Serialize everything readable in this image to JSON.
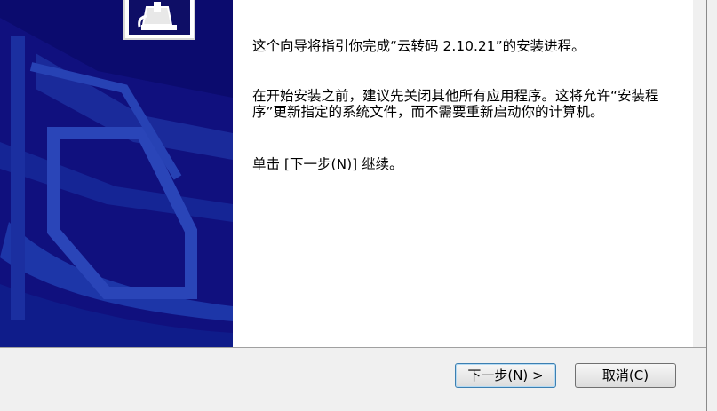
{
  "content": {
    "intro": "这个向导将指引你完成“云转码 2.10.21”的安装进程。",
    "advice": "在开始安装之前，建议先关闭其他所有应用程序。这将允许“安装程序”更新指定的系统文件，而不需要重新启动你的计算机。",
    "instruction": "单击 [下一步(N)] 继续。"
  },
  "buttons": {
    "next_label": "下一步(N) >",
    "cancel_label": "取消(C)"
  },
  "colors": {
    "sidebar": "#0b0b6e",
    "content_bg": "#ffffff",
    "button_focus_border": "#3c7fb1"
  },
  "icons": {
    "installer_logo": "installer-box-icon"
  }
}
